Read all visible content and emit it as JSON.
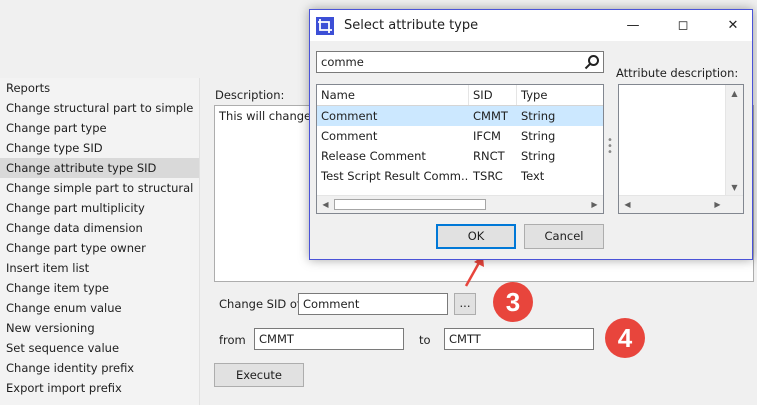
{
  "sidebar": {
    "items": [
      {
        "label": "Reports"
      },
      {
        "label": "Change structural part to simple"
      },
      {
        "label": "Change part type"
      },
      {
        "label": "Change type SID"
      },
      {
        "label": "Change attribute type SID",
        "selected": true
      },
      {
        "label": "Change simple part to structural"
      },
      {
        "label": "Change part multiplicity"
      },
      {
        "label": "Change data dimension"
      },
      {
        "label": "Change part type owner"
      },
      {
        "label": "Insert item list"
      },
      {
        "label": "Change item type"
      },
      {
        "label": "Change enum value"
      },
      {
        "label": "New versioning"
      },
      {
        "label": "Set sequence value"
      },
      {
        "label": "Change identity prefix"
      },
      {
        "label": "Export import prefix"
      }
    ]
  },
  "main": {
    "description_label": "Description:",
    "description_text": "This will change t",
    "change_sid_label": "Change SID of",
    "change_sid_value": "Comment",
    "browse_label": "...",
    "from_label": "from",
    "from_value": "CMMT",
    "to_label": "to",
    "to_value": "CMTT",
    "execute_label": "Execute"
  },
  "annotations": {
    "badge_3": "3",
    "badge_4": "4"
  },
  "dialog": {
    "title": "Select attribute type",
    "search_value": "comme",
    "columns": [
      "Name",
      "SID",
      "Type"
    ],
    "rows": [
      {
        "name": "Comment",
        "sid": "CMMT",
        "type": "String"
      },
      {
        "name": "Comment",
        "sid": "IFCM",
        "type": "String"
      },
      {
        "name": "Release Comment",
        "sid": "RNCT",
        "type": "String"
      },
      {
        "name": "Test Script Result Comm...",
        "sid": "TSRC",
        "type": "Text"
      }
    ],
    "attr_desc_label": "Attribute description:",
    "ok_label": "OK",
    "cancel_label": "Cancel"
  },
  "colors": {
    "accent": "#3c4fd6",
    "selection": "#cce8ff",
    "badge": "#e8453c"
  },
  "icons": [
    "crop-icon",
    "minimize-icon",
    "maximize-icon",
    "close-icon",
    "search-icon",
    "arrow-icon"
  ]
}
